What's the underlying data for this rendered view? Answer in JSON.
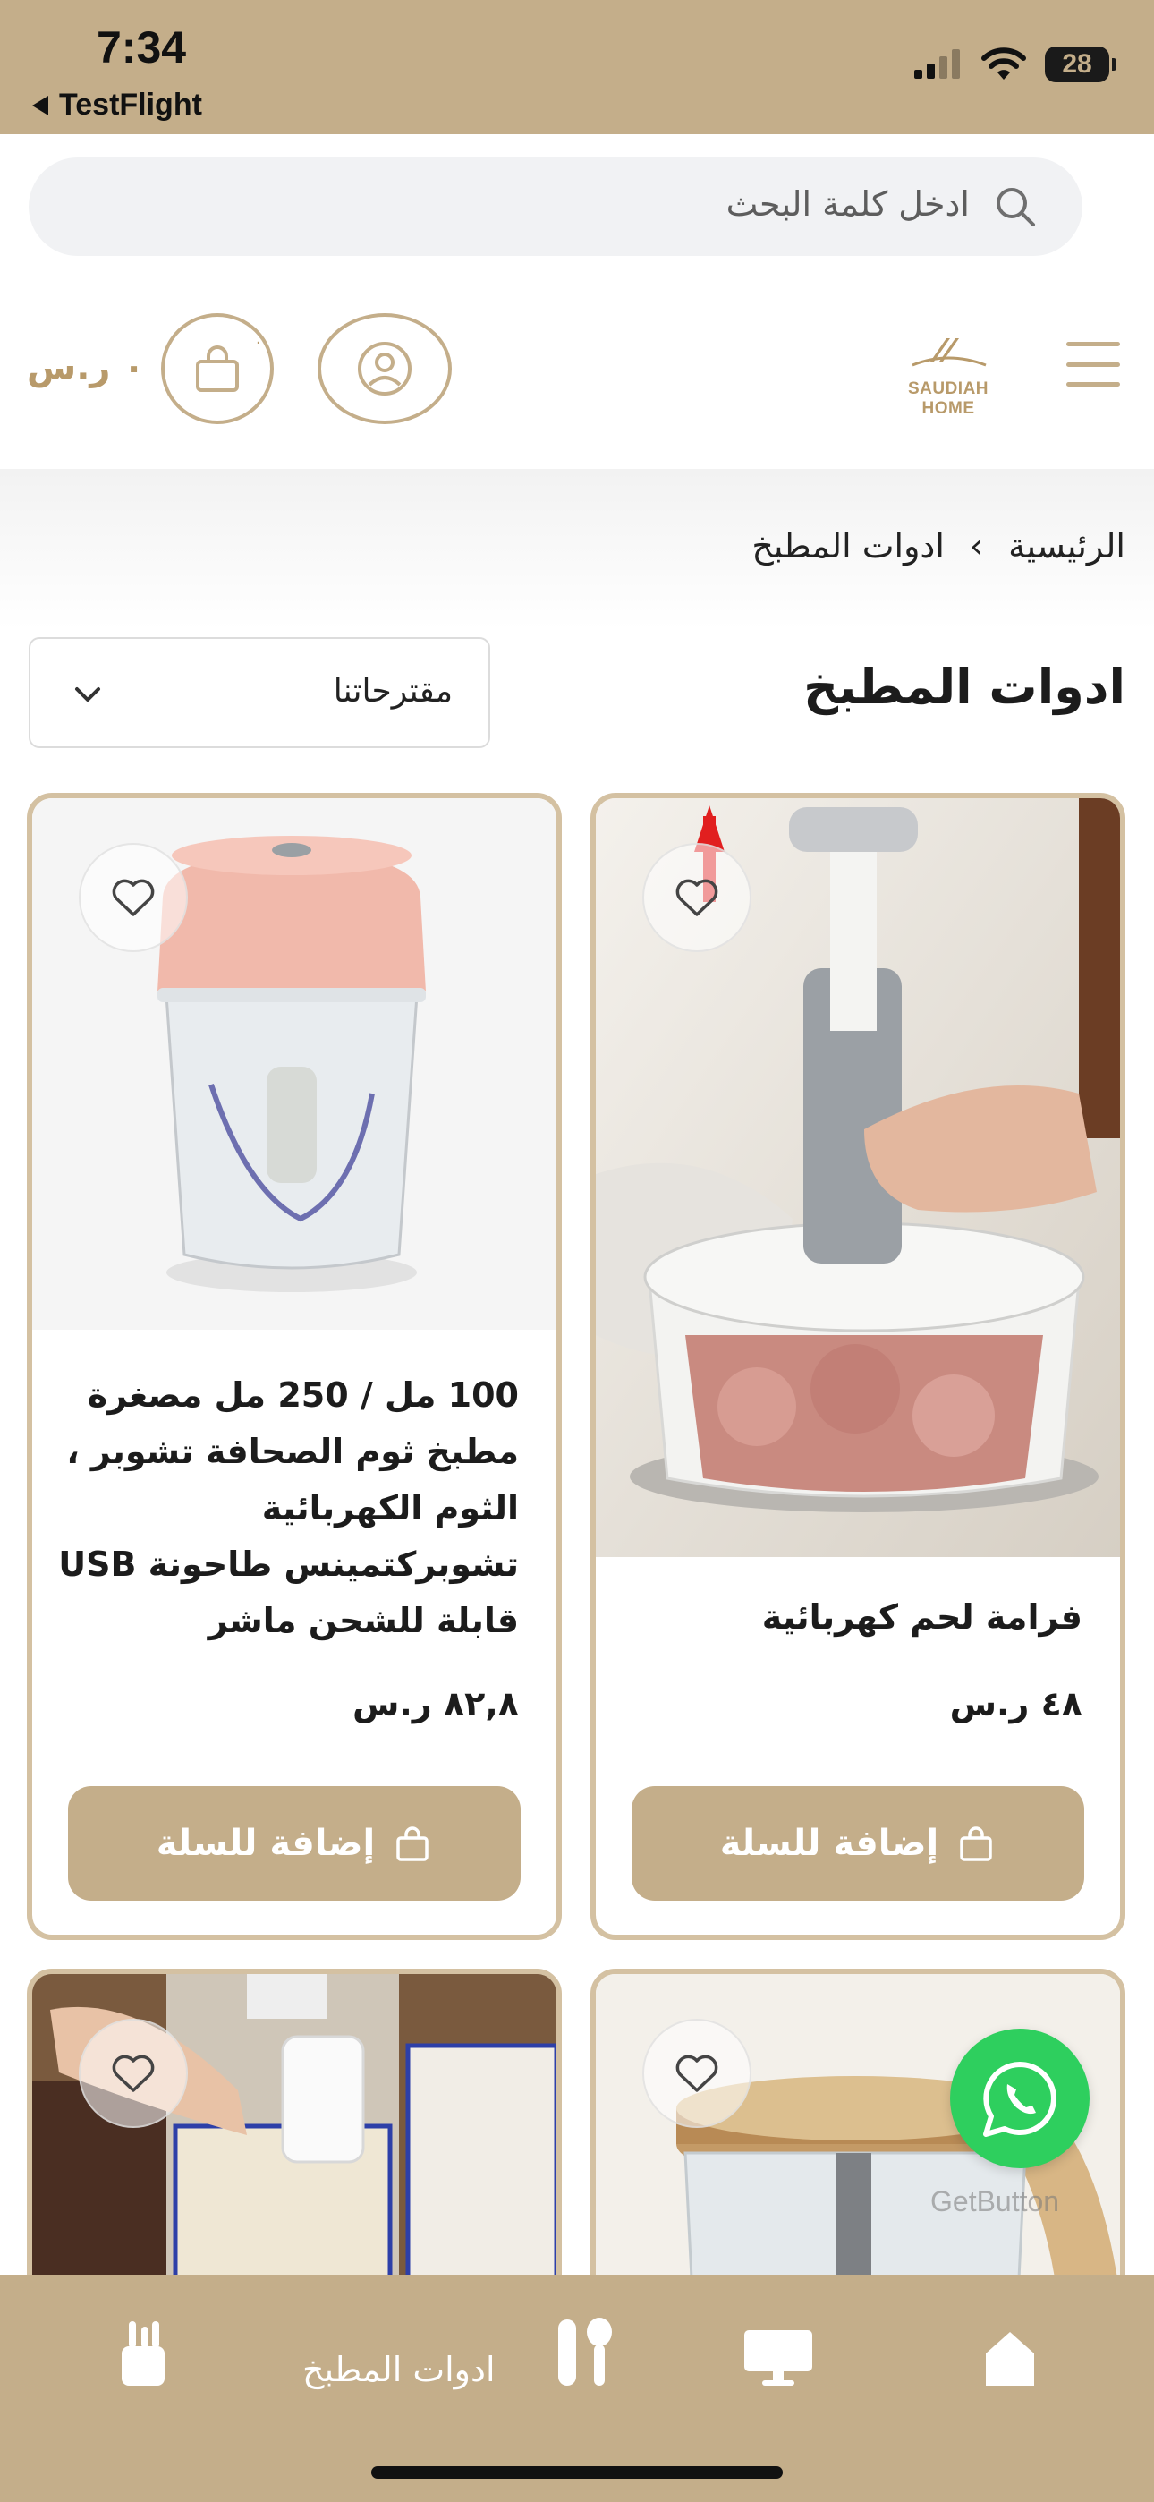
{
  "status_bar": {
    "time": "7:34",
    "back_app": "TestFlight",
    "battery": "28"
  },
  "search": {
    "placeholder": "ادخل كلمة البحث"
  },
  "header": {
    "logo_text": "SAUDIAH HOME",
    "cart_total": "٠ ر.س",
    "cart_count": "٠"
  },
  "breadcrumb": {
    "home": "الرئيسية",
    "current": "ادوات المطبخ"
  },
  "page_title": "ادوات المطبخ",
  "sort": {
    "selected": "مقترحاتنا"
  },
  "products": [
    {
      "name": "فرامة لحم كهربائية",
      "price": "٤٨ ر.س",
      "button": "إضافة للسلة"
    },
    {
      "name": "100 مل / 250 مل مصغرة مطبخ ثوم الصحافة تشوبر ، الثوم الكهربائية تشوبركتمينس طاحونة USB قابلة للشحن ماشر",
      "price": "٨٢,٨ ر.س",
      "button": "إضافة للسلة"
    }
  ],
  "getbutton_label": "GetButton",
  "bottom_nav": {
    "category_label": "ادوات المطبخ"
  },
  "colors": {
    "brand": "#c4ae8a",
    "card_border": "#d4c1a2",
    "whatsapp": "#2ecf5e"
  }
}
